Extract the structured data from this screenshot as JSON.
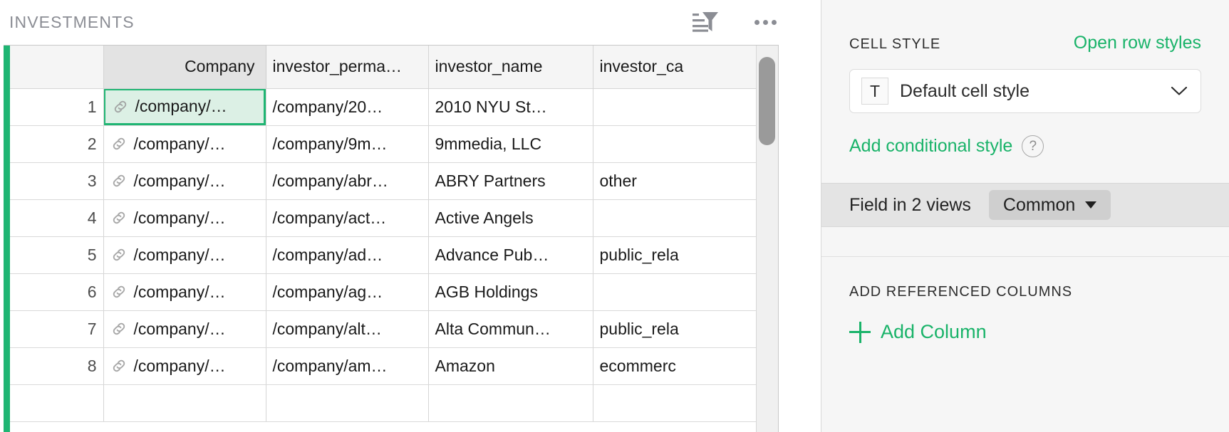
{
  "grid": {
    "title": "INVESTMENTS",
    "tools": [
      {
        "name": "filter-sort-icon",
        "label": "Sort and filter"
      },
      {
        "name": "more-options-icon",
        "label": "More options"
      }
    ],
    "columns": [
      {
        "key": "num",
        "header": ""
      },
      {
        "key": "company",
        "header": "Company"
      },
      {
        "key": "investor_permalink",
        "header": "investor_perma…"
      },
      {
        "key": "investor_name",
        "header": "investor_name"
      },
      {
        "key": "investor_category",
        "header": "investor_ca"
      }
    ],
    "cell_icon": "link-icon",
    "rows": [
      {
        "num": "1",
        "company": "/company/…",
        "investor_permalink": "/company/20…",
        "investor_name": "2010 NYU St…",
        "investor_category": ""
      },
      {
        "num": "2",
        "company": "/company/…",
        "investor_permalink": "/company/9m…",
        "investor_name": "9mmedia, LLC",
        "investor_category": ""
      },
      {
        "num": "3",
        "company": "/company/…",
        "investor_permalink": "/company/abr…",
        "investor_name": "ABRY Partners",
        "investor_category": "other"
      },
      {
        "num": "4",
        "company": "/company/…",
        "investor_permalink": "/company/act…",
        "investor_name": "Active Angels",
        "investor_category": ""
      },
      {
        "num": "5",
        "company": "/company/…",
        "investor_permalink": "/company/ad…",
        "investor_name": "Advance Pub…",
        "investor_category": "public_rela"
      },
      {
        "num": "6",
        "company": "/company/…",
        "investor_permalink": "/company/ag…",
        "investor_name": "AGB Holdings",
        "investor_category": ""
      },
      {
        "num": "7",
        "company": "/company/…",
        "investor_permalink": "/company/alt…",
        "investor_name": "Alta Commun…",
        "investor_category": "public_rela"
      },
      {
        "num": "8",
        "company": "/company/…",
        "investor_permalink": "/company/am…",
        "investor_name": "Amazon",
        "investor_category": "ecommerc"
      },
      {
        "num": "",
        "company": "",
        "investor_permalink": "",
        "investor_name": "",
        "investor_category": ""
      }
    ],
    "active_cell": {
      "row": 0,
      "column": "company"
    }
  },
  "panel": {
    "cell_style": {
      "section_label": "CELL STYLE",
      "open_row_styles_label": "Open row styles",
      "selected_style": "Default cell style",
      "style_type_glyph": "T",
      "add_conditional_label": "Add conditional style",
      "help_glyph": "?"
    },
    "views": {
      "label": "Field in 2 views",
      "chip_label": "Common"
    },
    "referenced_columns": {
      "section_label": "ADD REFERENCED COLUMNS",
      "add_column_label": "Add Column"
    }
  },
  "colors": {
    "accent_green": "#19b369",
    "rail_green": "#1fb573",
    "cell_mint": "#dcf0e5",
    "panel_bg": "#f6f6f6",
    "band_gray": "#e4e4e4",
    "rownum_gray": "#e6e6e6",
    "title_gray": "#8b8d94"
  }
}
